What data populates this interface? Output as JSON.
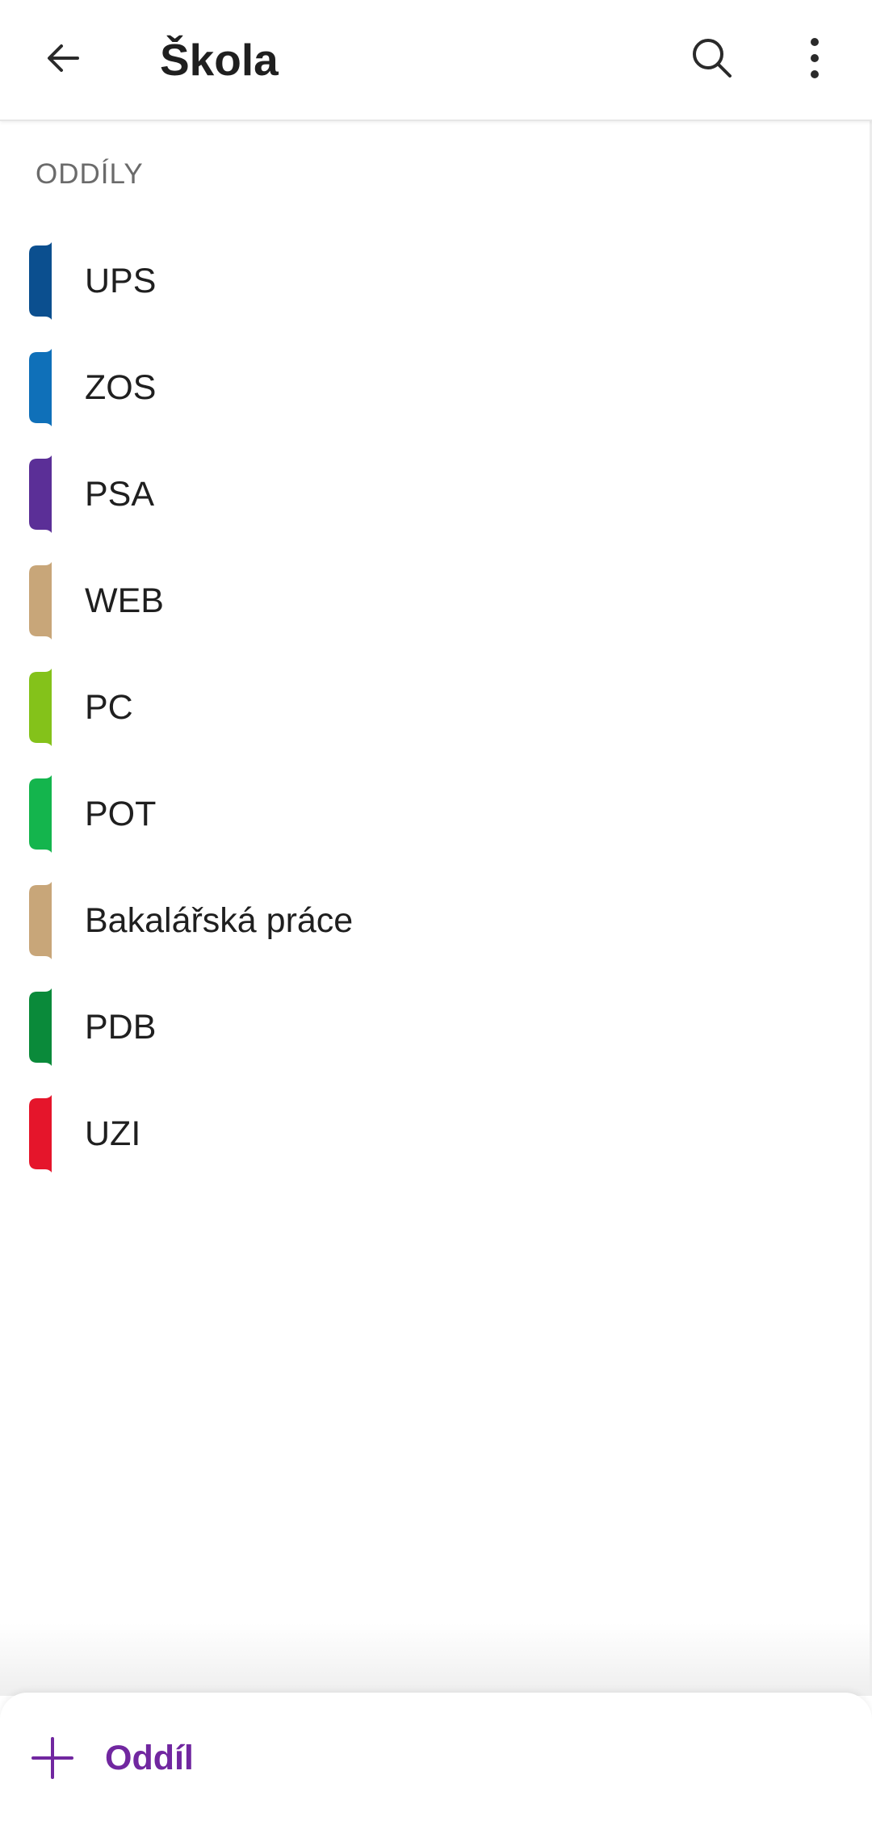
{
  "appbar": {
    "title": "Škola",
    "back_icon": "arrow-left-icon",
    "search_icon": "search-icon",
    "more_icon": "more-vertical-icon"
  },
  "sections_header": "ODDÍLY",
  "sections": [
    {
      "label": "UPS",
      "color": "#0b4f8f"
    },
    {
      "label": "ZOS",
      "color": "#0f70b9"
    },
    {
      "label": "PSA",
      "color": "#5b2f97"
    },
    {
      "label": "WEB",
      "color": "#c8a679"
    },
    {
      "label": "PC",
      "color": "#84c21a"
    },
    {
      "label": "POT",
      "color": "#14b54d"
    },
    {
      "label": "Bakalářská práce",
      "color": "#c8a679"
    },
    {
      "label": "PDB",
      "color": "#0a8a3a"
    },
    {
      "label": "UZI",
      "color": "#e5152b"
    }
  ],
  "bottom_bar": {
    "add_label": "Oddíl",
    "add_icon": "plus-icon",
    "accent": "#7127a0"
  }
}
